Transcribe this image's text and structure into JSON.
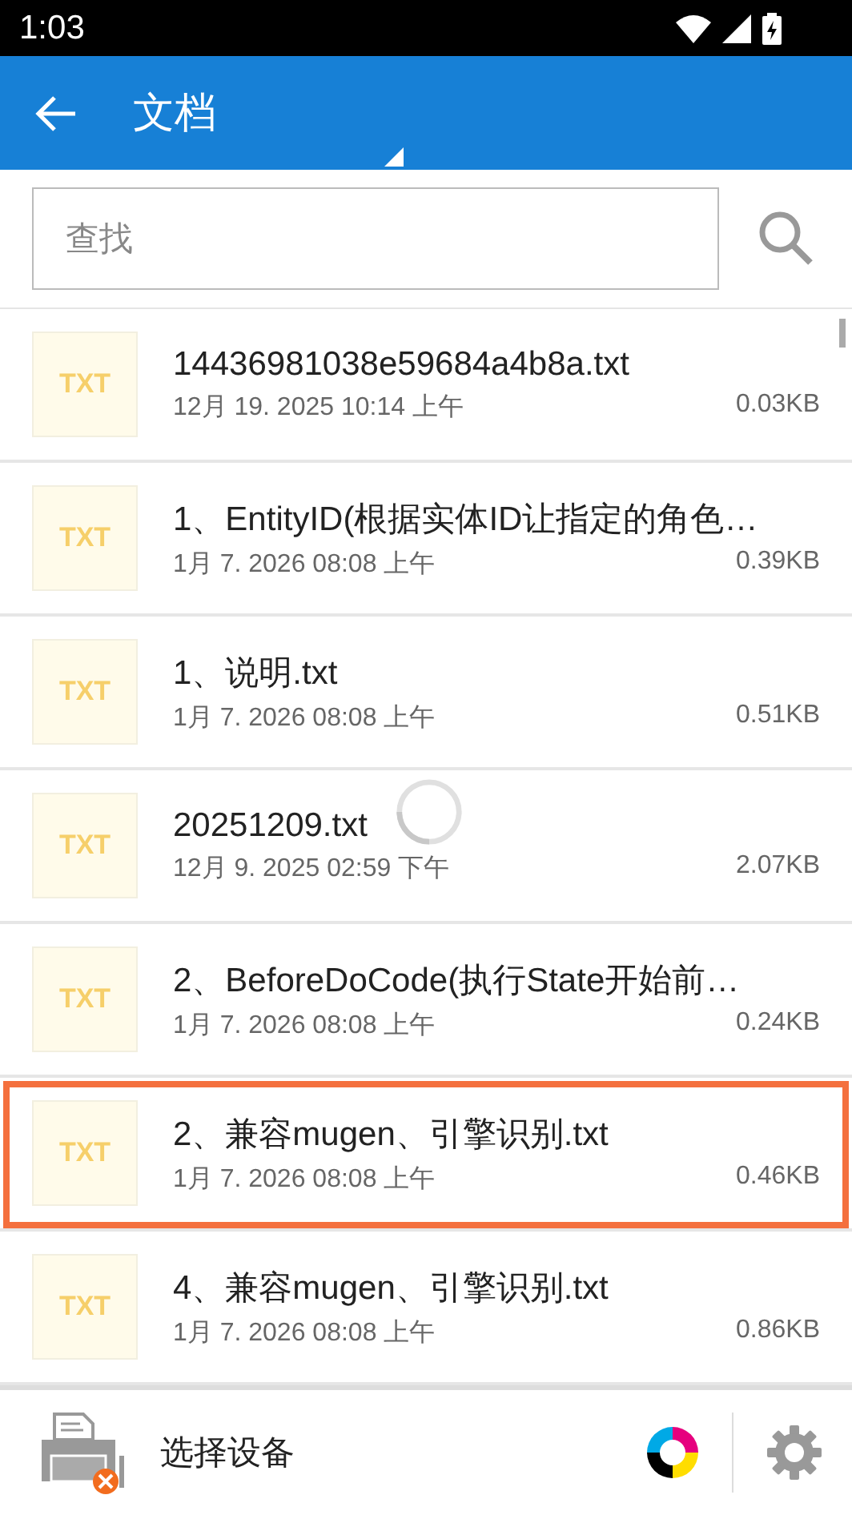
{
  "status_bar": {
    "time": "1:03"
  },
  "app_bar": {
    "title": "文档"
  },
  "search": {
    "placeholder": "查找"
  },
  "files": [
    {
      "type_label": "TXT",
      "name": "14436981038e59684a4b8a.txt",
      "date": "12月 19. 2025 10:14 上午",
      "size": "0.03KB",
      "highlighted": false
    },
    {
      "type_label": "TXT",
      "name": "1、EntityID(根据实体ID让指定的角色…",
      "date": "1月 7. 2026 08:08 上午",
      "size": "0.39KB",
      "highlighted": false
    },
    {
      "type_label": "TXT",
      "name": "1、说明.txt",
      "date": "1月 7. 2026 08:08 上午",
      "size": "0.51KB",
      "highlighted": false
    },
    {
      "type_label": "TXT",
      "name": "20251209.txt",
      "date": "12月 9. 2025 02:59 下午",
      "size": "2.07KB",
      "highlighted": false
    },
    {
      "type_label": "TXT",
      "name": "2、BeforeDoCode(执行State开始前…",
      "date": "1月 7. 2026 08:08 上午",
      "size": "0.24KB",
      "highlighted": false
    },
    {
      "type_label": "TXT",
      "name": "2、兼容mugen、引擎识别.txt",
      "date": "1月 7. 2026 08:08 上午",
      "size": "0.46KB",
      "highlighted": true
    },
    {
      "type_label": "TXT",
      "name": "4、兼容mugen、引擎识别.txt",
      "date": "1月 7. 2026 08:08 上午",
      "size": "0.86KB",
      "highlighted": false
    }
  ],
  "bottom_bar": {
    "device_label": "选择设备"
  }
}
